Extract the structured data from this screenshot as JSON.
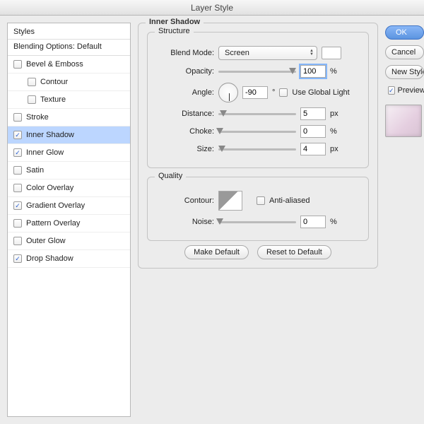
{
  "window": {
    "title": "Layer Style"
  },
  "styles": {
    "header": "Styles",
    "blending": "Blending Options: Default",
    "items": [
      {
        "label": "Bevel & Emboss",
        "checked": false
      },
      {
        "label": "Contour",
        "checked": false,
        "indent": true
      },
      {
        "label": "Texture",
        "checked": false,
        "indent": true
      },
      {
        "label": "Stroke",
        "checked": false
      },
      {
        "label": "Inner Shadow",
        "checked": true,
        "selected": true
      },
      {
        "label": "Inner Glow",
        "checked": true
      },
      {
        "label": "Satin",
        "checked": false
      },
      {
        "label": "Color Overlay",
        "checked": false
      },
      {
        "label": "Gradient Overlay",
        "checked": true
      },
      {
        "label": "Pattern Overlay",
        "checked": false
      },
      {
        "label": "Outer Glow",
        "checked": false
      },
      {
        "label": "Drop Shadow",
        "checked": true
      }
    ]
  },
  "panel": {
    "title": "Inner Shadow",
    "structure": {
      "title": "Structure",
      "blendModeLabel": "Blend Mode:",
      "blendModeValue": "Screen",
      "opacityLabel": "Opacity:",
      "opacityValue": "100",
      "opacityUnit": "%",
      "angleLabel": "Angle:",
      "angleValue": "-90",
      "angleUnit": "°",
      "useGlobalLabel": "Use Global Light",
      "useGlobalChecked": false,
      "distanceLabel": "Distance:",
      "distanceValue": "5",
      "distanceUnit": "px",
      "chokeLabel": "Choke:",
      "chokeValue": "0",
      "chokeUnit": "%",
      "sizeLabel": "Size:",
      "sizeValue": "4",
      "sizeUnit": "px"
    },
    "quality": {
      "title": "Quality",
      "contourLabel": "Contour:",
      "antiAliasedLabel": "Anti-aliased",
      "antiAliasedChecked": false,
      "noiseLabel": "Noise:",
      "noiseValue": "0",
      "noiseUnit": "%"
    },
    "buttons": {
      "makeDefault": "Make Default",
      "resetDefault": "Reset to Default"
    }
  },
  "right": {
    "ok": "OK",
    "cancel": "Cancel",
    "newStyle": "New Style...",
    "previewLabel": "Preview",
    "previewChecked": true
  }
}
